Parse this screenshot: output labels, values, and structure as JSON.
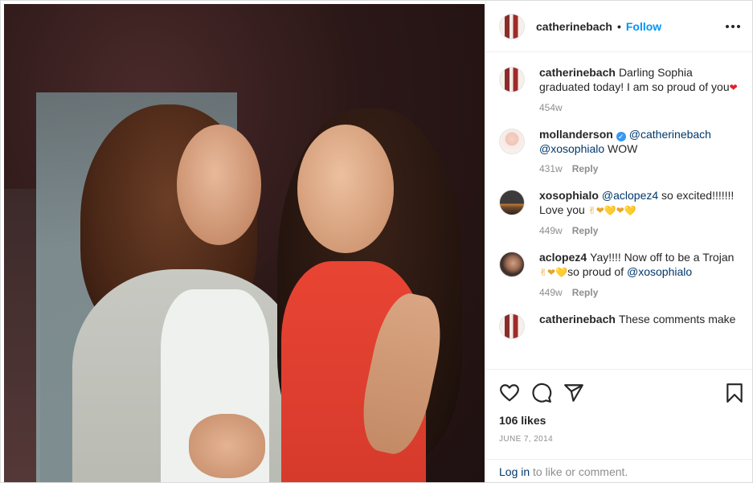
{
  "post": {
    "author": "catherinebach",
    "follow_label": "Follow",
    "separator": "•"
  },
  "caption": {
    "user": "catherinebach",
    "text": "Darling Sophia graduated today! I am so proud of you",
    "emoji": "❤",
    "time": "454w"
  },
  "comments": [
    {
      "user": "mollanderson",
      "verified": true,
      "mention1": "@catherinebach",
      "mention2": "@xosophialo",
      "text": " WOW",
      "time": "431w",
      "reply": "Reply"
    },
    {
      "user": "xosophialo",
      "mention1": "@aclopez4",
      "text": " so excited!!!!!!! Love you ",
      "emoji": "✌❤💛❤💛",
      "time": "449w",
      "reply": "Reply"
    },
    {
      "user": "aclopez4",
      "text1": "Yay!!!! Now off to be a Trojan ",
      "emoji": "✌❤💛",
      "text2": "so proud of ",
      "mention1": "@xosophialo",
      "time": "449w",
      "reply": "Reply"
    },
    {
      "user": "catherinebach",
      "text": "These comments make"
    }
  ],
  "stats": {
    "likes": "106 likes",
    "date": "JUNE 7, 2014"
  },
  "login": {
    "link": "Log in",
    "text": " to like or comment."
  },
  "icons": [
    "heart-icon",
    "comment-icon",
    "share-icon",
    "bookmark-icon",
    "more-icon",
    "verified-icon"
  ],
  "colors": {
    "accent": "#0095f6",
    "mention": "#00376b",
    "text": "#262626",
    "muted": "#8e8e8e",
    "verified": "#3897f0"
  }
}
